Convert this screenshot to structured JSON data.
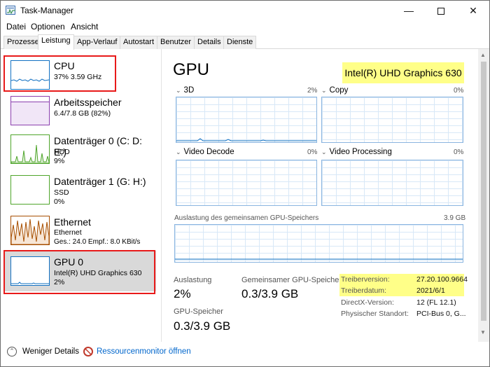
{
  "window": {
    "title": "Task-Manager",
    "minimize_icon": "minimize-icon",
    "maximize_icon": "maximize-icon",
    "close_icon": "close-icon"
  },
  "menu": [
    "Datei",
    "Optionen",
    "Ansicht"
  ],
  "tabs": [
    "Prozesse",
    "Leistung",
    "App-Verlauf",
    "Autostart",
    "Benutzer",
    "Details",
    "Dienste"
  ],
  "active_tab": "Leistung",
  "sidebar": {
    "items": [
      {
        "name": "CPU",
        "line1": "37%  3.59 GHz",
        "line2": "",
        "line3": "",
        "color": "#1170c2",
        "highlighted": true
      },
      {
        "name": "Arbeitsspeicher",
        "line1": "6.4/7.8 GB (82%)",
        "line2": "",
        "line3": "",
        "color": "#8b3fae",
        "fill": 0.82
      },
      {
        "name": "Datenträger 0 (C: D: E:)",
        "line1": "HDD",
        "line2": "9%",
        "line3": "",
        "color": "#4fa52b"
      },
      {
        "name": "Datenträger 1 (G: H:)",
        "line1": "SSD",
        "line2": "0%",
        "line3": "",
        "color": "#4fa52b"
      },
      {
        "name": "Ethernet",
        "line1": "Ethernet",
        "line2": "Ges.: 24.0  Empf.: 8.0 KBit/s",
        "line3": "",
        "color": "#a74f01"
      },
      {
        "name": "GPU 0",
        "line1": "Intel(R) UHD Graphics 630",
        "line2": "2%",
        "line3": "",
        "color": "#1170c2",
        "selected": true,
        "highlighted": true
      }
    ]
  },
  "main": {
    "title": "GPU",
    "model": "Intel(R) UHD Graphics 630",
    "engines": [
      {
        "label": "3D",
        "pct": "2%"
      },
      {
        "label": "Copy",
        "pct": "0%"
      },
      {
        "label": "Video Decode",
        "pct": "0%"
      },
      {
        "label": "Video Processing",
        "pct": "0%"
      }
    ],
    "shared_memory": {
      "label": "Auslastung des gemeinsamen GPU-Speichers",
      "max": "3.9 GB"
    },
    "stats": {
      "usage_label": "Auslastung",
      "usage_value": "2%",
      "shared_label": "Gemeinsamer GPU-Speicher",
      "shared_value": "0.3/3.9 GB",
      "gpu_mem_label": "GPU-Speicher",
      "gpu_mem_value": "0.3/3.9 GB"
    },
    "info": [
      {
        "key": "Treiberversion:",
        "value": "27.20.100.9664",
        "highlighted": true
      },
      {
        "key": "Treiberdatum:",
        "value": "2021/6/1",
        "highlighted": true
      },
      {
        "key": "DirectX-Version:",
        "value": "12 (FL 12.1)",
        "highlighted": false
      },
      {
        "key": "Physischer Standort:",
        "value": "PCI-Bus 0, G...",
        "highlighted": false
      }
    ]
  },
  "footer": {
    "fewer_details": "Weniger Details",
    "resource_monitor": "Ressourcenmonitor öffnen"
  },
  "colors": {
    "highlight_box": "#e81a1a",
    "yellow_highlight": "#ffff88",
    "graph_border": "#8ab5e0",
    "link": "#0066cc"
  }
}
